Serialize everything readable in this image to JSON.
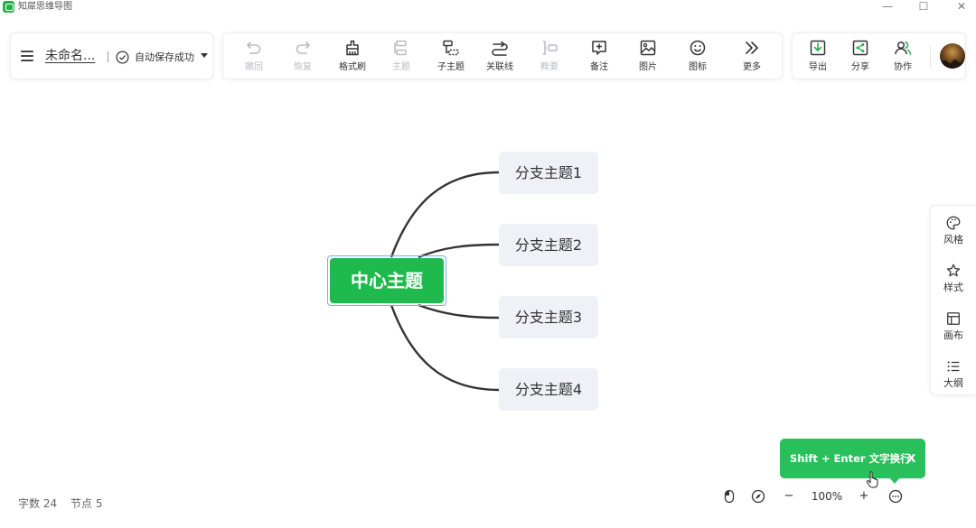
{
  "window": {
    "title": "知犀思维导图",
    "controls": {
      "minimize": "—",
      "maximize": "☐",
      "close": "✕"
    }
  },
  "header": {
    "doc_title": "未命名...",
    "save_status": "自动保存成功"
  },
  "toolbar": {
    "items": [
      {
        "label": "撤回",
        "icon": "undo-icon",
        "enabled": false
      },
      {
        "label": "恢复",
        "icon": "redo-icon",
        "enabled": false
      },
      {
        "label": "格式刷",
        "icon": "format-brush-icon",
        "enabled": true
      },
      {
        "label": "主题",
        "icon": "topic-icon",
        "enabled": false
      },
      {
        "label": "子主题",
        "icon": "subtopic-icon",
        "enabled": true
      },
      {
        "label": "关联线",
        "icon": "relation-line-icon",
        "enabled": true
      },
      {
        "label": "概要",
        "icon": "summary-icon",
        "enabled": false
      },
      {
        "label": "备注",
        "icon": "note-icon",
        "enabled": true
      },
      {
        "label": "图片",
        "icon": "image-icon",
        "enabled": true
      },
      {
        "label": "图标",
        "icon": "emoji-icon",
        "enabled": true
      },
      {
        "label": "更多",
        "icon": "more-icon",
        "enabled": true
      }
    ]
  },
  "actions": {
    "export_label": "导出",
    "share_label": "分享",
    "collab_label": "协作"
  },
  "mindmap": {
    "center": "中心主题",
    "branches": [
      "分支主题1",
      "分支主题2",
      "分支主题3",
      "分支主题4"
    ]
  },
  "side_panel": {
    "items": [
      {
        "label": "风格",
        "icon": "palette-icon"
      },
      {
        "label": "样式",
        "icon": "style-icon"
      },
      {
        "label": "画布",
        "icon": "canvas-icon"
      },
      {
        "label": "大纲",
        "icon": "outline-icon"
      }
    ]
  },
  "toast": {
    "text": "Shift + Enter 文字换行",
    "close": "X"
  },
  "status_bar": {
    "word_count": "字数 24",
    "node_count": "节点 5"
  },
  "zoom": {
    "minus": "−",
    "level": "100%",
    "plus": "+"
  },
  "colors": {
    "brand_green": "#1fba4d",
    "toast_green": "#29c05c",
    "selection_blue": "#67b6ff",
    "branch_bg": "#eef1f5"
  }
}
